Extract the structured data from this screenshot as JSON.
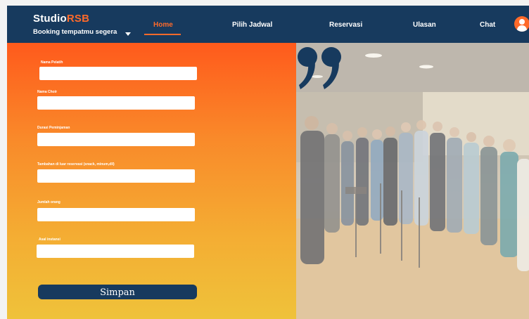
{
  "brand": {
    "name_main": "Studio",
    "name_accent": "RSB",
    "tagline": "Booking tempatmu segera"
  },
  "nav": {
    "items": [
      {
        "label": "Home",
        "active": true
      },
      {
        "label": "Pilih Jadwal",
        "active": false
      },
      {
        "label": "Reservasi",
        "active": false
      },
      {
        "label": "Ulasan",
        "active": false
      },
      {
        "label": "Chat",
        "active": false
      }
    ]
  },
  "icons": {
    "user": "user-avatar-icon",
    "dropdown": "caret-down-icon",
    "quote": "quote-icon"
  },
  "form": {
    "fields": [
      {
        "label": "Nama Pelatih",
        "value": "",
        "placeholder": ""
      },
      {
        "label": "Nama Choir",
        "value": "",
        "placeholder": ""
      },
      {
        "label": "Durasi Peminjaman",
        "value": "",
        "placeholder": ""
      },
      {
        "label": "Tambahan di luar reservasi (snack, minum,dll)",
        "value": "",
        "placeholder": ""
      },
      {
        "label": "Jumlah orang",
        "value": "",
        "placeholder": ""
      },
      {
        "label": "Asal instansi",
        "value": "",
        "placeholder": ""
      }
    ],
    "submit_label": "Simpan"
  },
  "colors": {
    "navy": "#173a5e",
    "accent": "#ff6a2a",
    "gradient_top": "#ff5a1c",
    "gradient_bottom": "#efc23a"
  }
}
